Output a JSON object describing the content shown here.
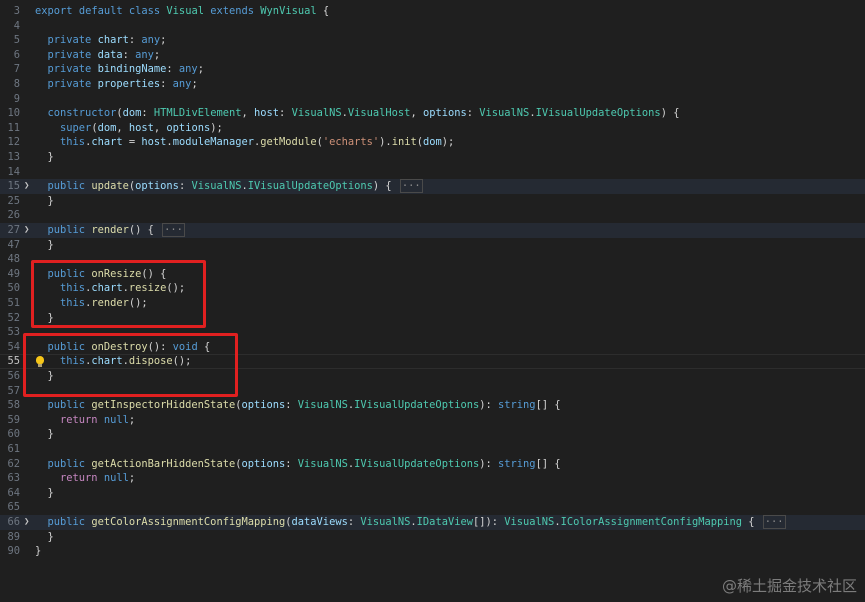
{
  "editor": {
    "lines": [
      {
        "n": "3",
        "folded": false,
        "code": "export default class Visual extends WynVisual {"
      },
      {
        "n": "4",
        "folded": false,
        "code": ""
      },
      {
        "n": "5",
        "folded": false,
        "code": "  private chart: any;"
      },
      {
        "n": "6",
        "folded": false,
        "code": "  private data: any;"
      },
      {
        "n": "7",
        "folded": false,
        "code": "  private bindingName: any;"
      },
      {
        "n": "8",
        "folded": false,
        "code": "  private properties: any;"
      },
      {
        "n": "9",
        "folded": false,
        "code": ""
      },
      {
        "n": "10",
        "folded": false,
        "code": "  constructor(dom: HTMLDivElement, host: VisualNS.VisualHost, options: VisualNS.IVisualUpdateOptions) {"
      },
      {
        "n": "11",
        "folded": false,
        "code": "    super(dom, host, options);"
      },
      {
        "n": "12",
        "folded": false,
        "code": "    this.chart = host.moduleManager.getModule('echarts').init(dom);"
      },
      {
        "n": "13",
        "folded": false,
        "code": "  }"
      },
      {
        "n": "14",
        "folded": false,
        "code": ""
      },
      {
        "n": "15",
        "folded": true,
        "code": "  public update(options: VisualNS.IVisualUpdateOptions) {"
      },
      {
        "n": "25",
        "folded": false,
        "code": "  }"
      },
      {
        "n": "26",
        "folded": false,
        "code": ""
      },
      {
        "n": "27",
        "folded": true,
        "code": "  public render() {"
      },
      {
        "n": "47",
        "folded": false,
        "code": "  }"
      },
      {
        "n": "48",
        "folded": false,
        "code": ""
      },
      {
        "n": "49",
        "folded": false,
        "code": "  public onResize() {"
      },
      {
        "n": "50",
        "folded": false,
        "code": "    this.chart.resize();"
      },
      {
        "n": "51",
        "folded": false,
        "code": "    this.render();"
      },
      {
        "n": "52",
        "folded": false,
        "code": "  }"
      },
      {
        "n": "53",
        "folded": false,
        "code": ""
      },
      {
        "n": "54",
        "folded": false,
        "code": "  public onDestroy(): void {"
      },
      {
        "n": "55",
        "folded": false,
        "code": "    this.chart.dispose();",
        "current": true,
        "lightbulb": true
      },
      {
        "n": "56",
        "folded": false,
        "code": "  }"
      },
      {
        "n": "57",
        "folded": false,
        "code": ""
      },
      {
        "n": "58",
        "folded": false,
        "code": "  public getInspectorHiddenState(options: VisualNS.IVisualUpdateOptions): string[] {"
      },
      {
        "n": "59",
        "folded": false,
        "code": "    return null;"
      },
      {
        "n": "60",
        "folded": false,
        "code": "  }"
      },
      {
        "n": "61",
        "folded": false,
        "code": ""
      },
      {
        "n": "62",
        "folded": false,
        "code": "  public getActionBarHiddenState(options: VisualNS.IVisualUpdateOptions): string[] {"
      },
      {
        "n": "63",
        "folded": false,
        "code": "    return null;"
      },
      {
        "n": "64",
        "folded": false,
        "code": "  }"
      },
      {
        "n": "65",
        "folded": false,
        "code": ""
      },
      {
        "n": "66",
        "folded": true,
        "code": "  public getColorAssignmentConfigMapping(dataViews: VisualNS.IDataView[]): VisualNS.IColorAssignmentConfigMapping {"
      },
      {
        "n": "89",
        "folded": false,
        "code": "  }"
      },
      {
        "n": "90",
        "folded": false,
        "code": "}"
      }
    ],
    "fold_ellipsis": "···",
    "fold_icon": "chevron-right-icon",
    "lightbulb_icon": "lightbulb-icon"
  },
  "annotations": {
    "color": "#e02020",
    "boxes": [
      {
        "label": "onResize"
      },
      {
        "label": "onDestroy"
      }
    ]
  },
  "watermark": {
    "text": "@稀土掘金技术社区"
  }
}
